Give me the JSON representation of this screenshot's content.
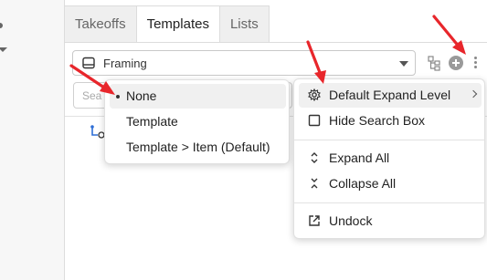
{
  "tabs": [
    {
      "label": "Takeoffs"
    },
    {
      "label": "Templates"
    },
    {
      "label": "Lists"
    }
  ],
  "template_select": {
    "value": "Framing"
  },
  "search": {
    "placeholder": "Sea"
  },
  "expand_level_menu": {
    "items": [
      {
        "label": "None",
        "selected": true
      },
      {
        "label": "Template"
      },
      {
        "label": "Template > Item (Default)"
      }
    ]
  },
  "options_menu": {
    "default_expand_level": "Default Expand Level",
    "hide_search_box": "Hide Search Box",
    "expand_all": "Expand All",
    "collapse_all": "Collapse All",
    "undock": "Undock"
  },
  "colors": {
    "annotation_arrow": "#e8262b",
    "accent": "#2f6fd6"
  },
  "icons": [
    "toolbar-tree-icon",
    "add-circle-icon",
    "kebab-menu-icon",
    "gear-icon",
    "checkbox-icon",
    "expand-icon",
    "collapse-icon",
    "undock-icon",
    "template-icon",
    "chevron-down-icon",
    "chevron-right-icon"
  ]
}
